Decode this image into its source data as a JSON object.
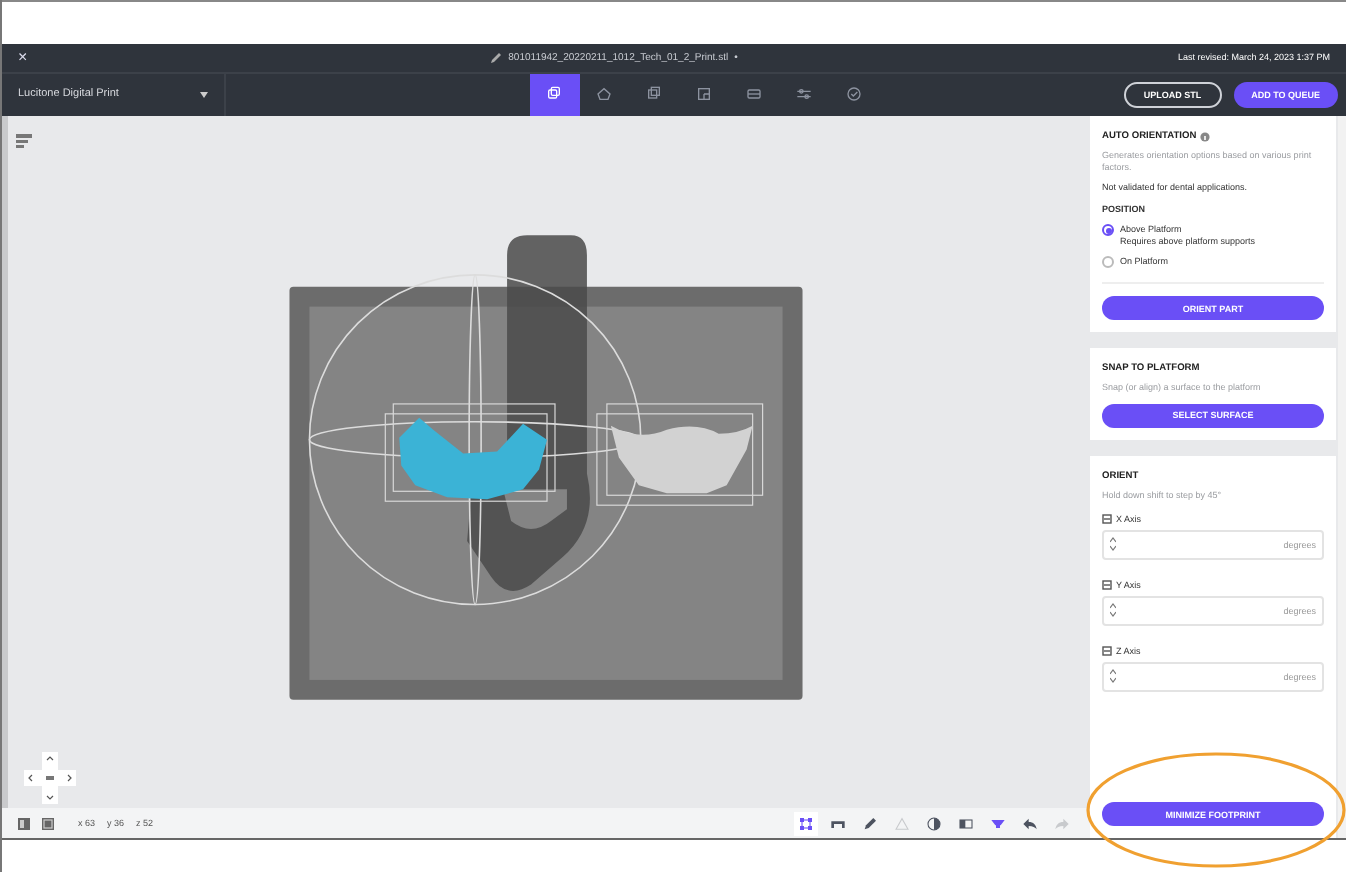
{
  "title_bar": {
    "close": "×",
    "file_name": "801011942_20220211_1012_Tech_01_2_Print.stl",
    "unsaved_mark": "•",
    "last_revised": "Last revised: March 24, 2023 1:37 PM"
  },
  "toolbar": {
    "printer": "Lucitone Digital Print",
    "tabs": [
      {
        "selected": true
      },
      {
        "selected": false
      },
      {
        "selected": false
      },
      {
        "selected": false
      },
      {
        "selected": false
      },
      {
        "selected": false
      },
      {
        "selected": false
      }
    ],
    "upload_button": "UPLOAD STL",
    "queue_button": "ADD TO QUEUE"
  },
  "status_bar": {
    "coordinates": [
      "x 63",
      "y 36",
      "z 52"
    ],
    "tools": [
      {
        "active": true,
        "disabled": false
      },
      {
        "active": false,
        "disabled": false
      },
      {
        "active": false,
        "disabled": false
      },
      {
        "active": false,
        "disabled": true
      },
      {
        "active": false,
        "disabled": false
      },
      {
        "active": false,
        "disabled": false
      },
      {
        "active": true,
        "disabled": false
      },
      {
        "active": false,
        "disabled": false
      },
      {
        "active": false,
        "disabled": true
      }
    ]
  },
  "panel": {
    "auto_orientation": {
      "title": "AUTO ORIENTATION",
      "description": "Generates orientation options based on various print factors.",
      "note": "Not validated for dental applications.",
      "position_label": "POSITION",
      "options": [
        {
          "label": "Above Platform",
          "sublabel": "Requires above platform supports",
          "selected": true
        },
        {
          "label": "On Platform",
          "selected": false
        }
      ],
      "button": "ORIENT PART"
    },
    "snap": {
      "title": "SNAP TO PLATFORM",
      "description": "Snap (or align) a surface to the platform",
      "button": "SELECT SURFACE"
    },
    "orient": {
      "title": "ORIENT",
      "hint": "Hold down shift to step by 45°",
      "axes": [
        {
          "label": "X Axis",
          "unit": "degrees"
        },
        {
          "label": "Y Axis",
          "unit": "degrees"
        },
        {
          "label": "Z Axis",
          "unit": "degrees"
        }
      ],
      "button": "MINIMIZE FOOTPRINT"
    }
  }
}
